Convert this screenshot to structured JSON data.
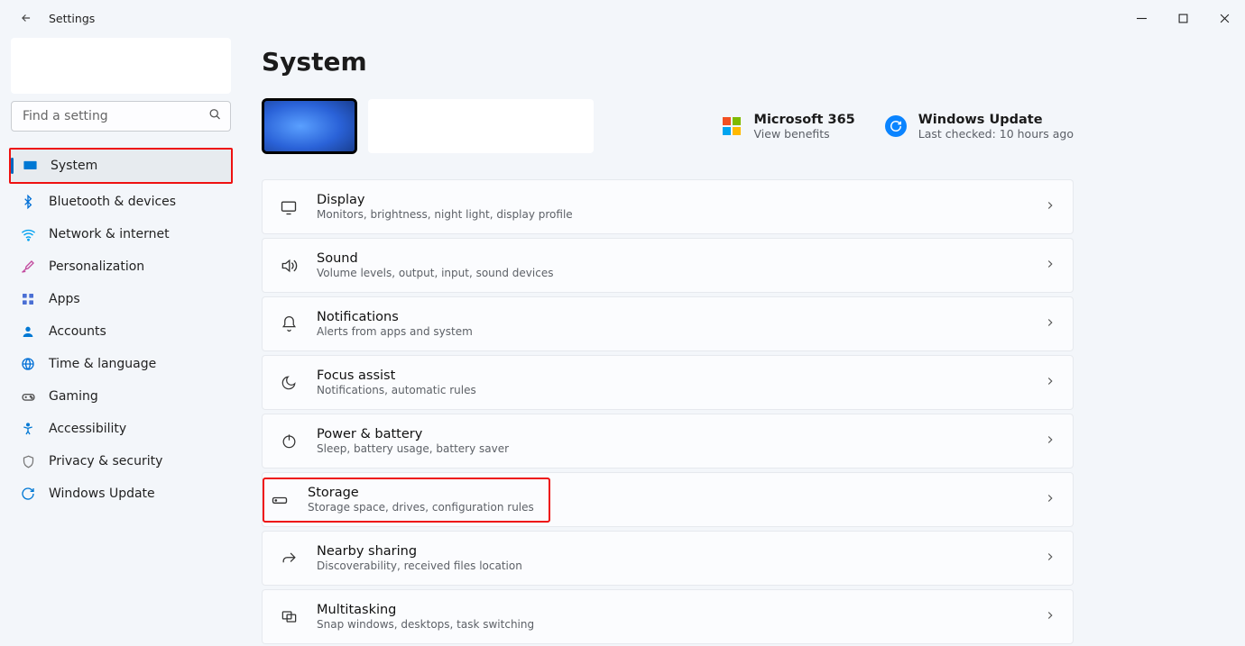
{
  "window": {
    "title": "Settings"
  },
  "search": {
    "placeholder": "Find a setting"
  },
  "nav": {
    "items": [
      {
        "label": "System"
      },
      {
        "label": "Bluetooth & devices"
      },
      {
        "label": "Network & internet"
      },
      {
        "label": "Personalization"
      },
      {
        "label": "Apps"
      },
      {
        "label": "Accounts"
      },
      {
        "label": "Time & language"
      },
      {
        "label": "Gaming"
      },
      {
        "label": "Accessibility"
      },
      {
        "label": "Privacy & security"
      },
      {
        "label": "Windows Update"
      }
    ]
  },
  "page": {
    "title": "System"
  },
  "aux": {
    "m365": {
      "title": "Microsoft 365",
      "sub": "View benefits"
    },
    "wu": {
      "title": "Windows Update",
      "sub": "Last checked: 10 hours ago"
    }
  },
  "rows": [
    {
      "title": "Display",
      "sub": "Monitors, brightness, night light, display profile"
    },
    {
      "title": "Sound",
      "sub": "Volume levels, output, input, sound devices"
    },
    {
      "title": "Notifications",
      "sub": "Alerts from apps and system"
    },
    {
      "title": "Focus assist",
      "sub": "Notifications, automatic rules"
    },
    {
      "title": "Power & battery",
      "sub": "Sleep, battery usage, battery saver"
    },
    {
      "title": "Storage",
      "sub": "Storage space, drives, configuration rules"
    },
    {
      "title": "Nearby sharing",
      "sub": "Discoverability, received files location"
    },
    {
      "title": "Multitasking",
      "sub": "Snap windows, desktops, task switching"
    }
  ]
}
